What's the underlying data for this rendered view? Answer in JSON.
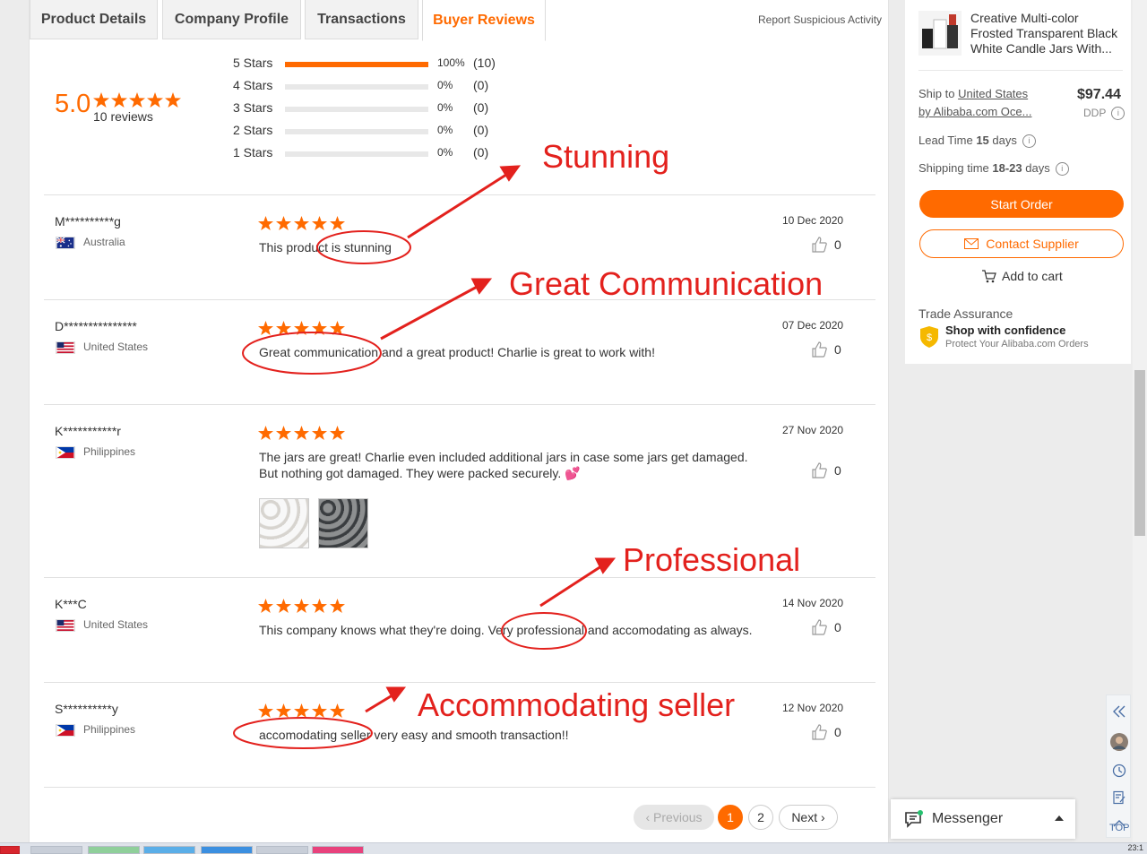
{
  "tabs": [
    {
      "label": "Product Details",
      "active": false
    },
    {
      "label": "Company Profile",
      "active": false
    },
    {
      "label": "Transactions",
      "active": false
    },
    {
      "label": "Buyer Reviews",
      "active": true
    }
  ],
  "report_link": "Report Suspicious Activity",
  "summary": {
    "score": "5.0",
    "stars": 5,
    "review_count": "10 reviews",
    "breakdown": [
      {
        "label": "5 Stars",
        "fraction": 1.0,
        "percent": "100%",
        "count": "(10)"
      },
      {
        "label": "4 Stars",
        "fraction": 0,
        "percent": "0%",
        "count": "(0)"
      },
      {
        "label": "3 Stars",
        "fraction": 0,
        "percent": "0%",
        "count": "(0)"
      },
      {
        "label": "2 Stars",
        "fraction": 0,
        "percent": "0%",
        "count": "(0)"
      },
      {
        "label": "1 Stars",
        "fraction": 0,
        "percent": "0%",
        "count": "(0)"
      }
    ]
  },
  "reviews": [
    {
      "name": "M**********g",
      "country": "Australia",
      "flag": "australia-flag",
      "stars": 5,
      "date": "10 Dec 2020",
      "text": "This product is stunning",
      "likes": "0"
    },
    {
      "name": "D***************",
      "country": "United States",
      "flag": "us-flag",
      "stars": 5,
      "date": "07 Dec 2020",
      "text": "Great communication and a great product! Charlie is great to work with!",
      "likes": "0"
    },
    {
      "name": "K***********r",
      "country": "Philippines",
      "flag": "philippines-flag",
      "stars": 5,
      "date": "27 Nov 2020",
      "text": "The jars are great! Charlie even included additional jars in case some jars get damaged. But nothing got damaged. They were packed securely. 💕",
      "likes": "0",
      "images": [
        "white-candle-jars-photo",
        "dark-candle-jars-photo"
      ]
    },
    {
      "name": "K***C",
      "country": "United States",
      "flag": "us-flag",
      "stars": 5,
      "date": "14 Nov 2020",
      "text": "This company knows what they're doing. Very professional and accomodating as always.",
      "likes": "0"
    },
    {
      "name": "S**********y",
      "country": "Philippines",
      "flag": "philippines-flag",
      "stars": 5,
      "date": "12 Nov 2020",
      "text": "accomodating seller very easy and smooth transaction!!",
      "likes": "0"
    }
  ],
  "pagination": {
    "previous": "Previous",
    "pages": [
      "1",
      "2"
    ],
    "current": "1",
    "next": "Next"
  },
  "annotations": [
    "Stunning",
    "Great Communication",
    "Professional",
    "Accommodating seller"
  ],
  "sidebar_card": {
    "product_title": "Creative Multi-color Frosted Transparent Black White Candle Jars With...",
    "ship_to_prefix": "Ship to ",
    "ship_to_country": "United States",
    "ship_by": "by Alibaba.com Oce...",
    "price": "$97.44",
    "price_term": "DDP",
    "lead_time_label": "Lead Time ",
    "lead_time_value": "15",
    "lead_time_unit": " days",
    "shipping_time_label": "Shipping time ",
    "shipping_time_value": "18-23",
    "shipping_time_unit": " days",
    "start_order": "Start Order",
    "contact_supplier": "Contact Supplier",
    "add_to_cart": "Add to cart",
    "trade_assurance": "Trade Assurance",
    "shop_confidence": "Shop with confidence",
    "protect_text": "Protect Your Alibaba.com Orders"
  },
  "tools": {
    "top_label": "TOP",
    "messenger": "Messenger"
  },
  "colors": {
    "accent": "#ff6a00",
    "annotation": "#e3211d"
  },
  "taskbar": {
    "clock": "23:1"
  }
}
